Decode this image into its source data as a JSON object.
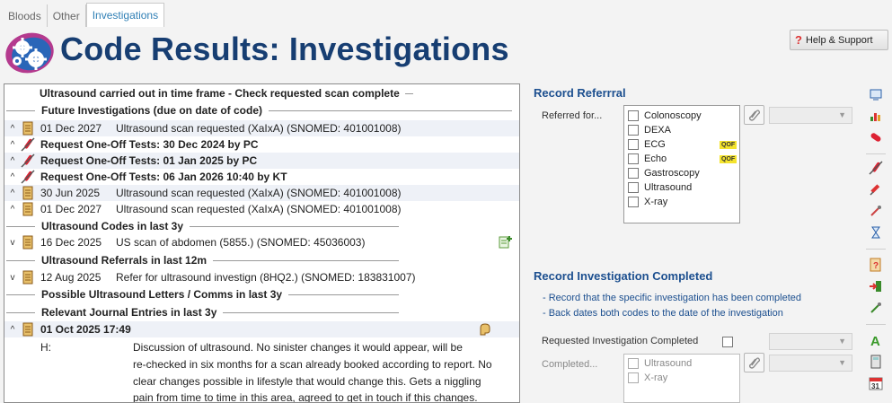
{
  "tabs": [
    {
      "label": "Bloods",
      "active": false
    },
    {
      "label": "Other",
      "active": false
    },
    {
      "label": "Investigations",
      "active": true
    }
  ],
  "header": {
    "title": "Code Results: Investigations",
    "help_label": "Help & Support"
  },
  "results": {
    "sections": {
      "s1": "Ultrasound carried out in time frame - Check requested scan complete",
      "s2": "Future Investigations (due on date of code)",
      "s3": "Ultrasound Codes in last 3y",
      "s4": "Ultrasound Referrals in last 12m",
      "s5": "Possible Ultrasound Letters / Comms in last 3y",
      "s6": "Relevant Journal Entries in last 3y"
    },
    "rows": [
      {
        "date": "01 Dec 2027",
        "desc": "Ultrasound scan requested (XaIxA) (SNOMED: 401001008)"
      },
      {
        "desc": "Request One-Off Tests: 30 Dec 2024 by PC"
      },
      {
        "desc": "Request One-Off Tests: 01 Jan 2025 by PC"
      },
      {
        "desc": "Request One-Off Tests: 06 Jan 2026 10:40 by KT"
      },
      {
        "date": "30 Jun 2025",
        "desc": "Ultrasound scan requested (XaIxA) (SNOMED: 401001008)"
      },
      {
        "date": "01 Dec 2027",
        "desc": "Ultrasound scan requested (XaIxA) (SNOMED: 401001008)"
      },
      {
        "date": "16 Dec 2025",
        "desc": "US scan of abdomen (5855.) (SNOMED: 45036003)"
      },
      {
        "date": "12 Aug 2025",
        "desc": "Refer for ultrasound investign (8HQ2.) (SNOMED: 183831007)"
      }
    ],
    "journal": {
      "date": "01 Oct 2025 17:49",
      "label": "H:",
      "lines": [
        "Discussion of ultrasound. No sinister changes it would appear, will be",
        "re-checked in six months for a scan already booked according to report. No",
        "clear changes possible in lifestyle that would change this. Gets a niggling",
        "pain from time to time in this area, agreed to get in touch if this changes."
      ]
    }
  },
  "referral": {
    "title": "Record Referrral",
    "referred_for_label": "Referred for...",
    "qof_badge": "QOF",
    "options": [
      "Colonoscopy",
      "DEXA",
      "ECG",
      "Echo",
      "Gastroscopy",
      "Ultrasound",
      "X-ray"
    ]
  },
  "completed": {
    "title": "Record Investigation Completed",
    "bullets": [
      "- Record that the specific investigation has been completed",
      "- Back dates both codes to the date of the investigation"
    ],
    "requested_label": "Requested Investigation Completed",
    "completed_label": "Completed...",
    "options": [
      "Ultrasound",
      "X-ray"
    ]
  },
  "colors": {
    "title": "#173e72",
    "accent": "#1c4f8f",
    "tab_active": "#2f7fb5",
    "qof": "#f4e32c"
  }
}
